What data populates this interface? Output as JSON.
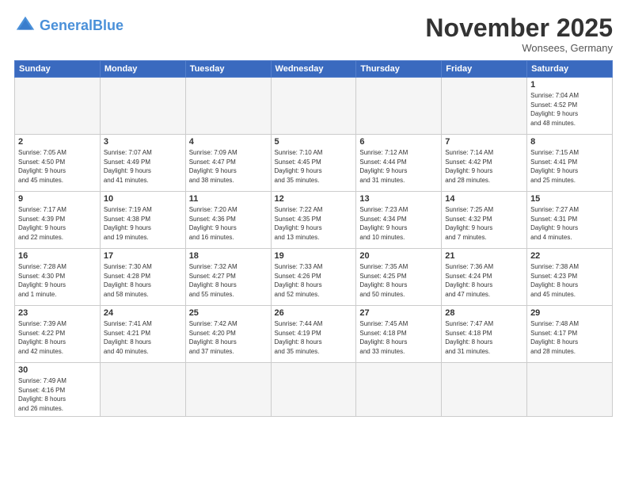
{
  "header": {
    "logo_general": "General",
    "logo_blue": "Blue",
    "month_title": "November 2025",
    "location": "Wonsees, Germany"
  },
  "weekdays": [
    "Sunday",
    "Monday",
    "Tuesday",
    "Wednesday",
    "Thursday",
    "Friday",
    "Saturday"
  ],
  "weeks": [
    [
      {
        "day": "",
        "info": ""
      },
      {
        "day": "",
        "info": ""
      },
      {
        "day": "",
        "info": ""
      },
      {
        "day": "",
        "info": ""
      },
      {
        "day": "",
        "info": ""
      },
      {
        "day": "",
        "info": ""
      },
      {
        "day": "1",
        "info": "Sunrise: 7:04 AM\nSunset: 4:52 PM\nDaylight: 9 hours\nand 48 minutes."
      }
    ],
    [
      {
        "day": "2",
        "info": "Sunrise: 7:05 AM\nSunset: 4:50 PM\nDaylight: 9 hours\nand 45 minutes."
      },
      {
        "day": "3",
        "info": "Sunrise: 7:07 AM\nSunset: 4:49 PM\nDaylight: 9 hours\nand 41 minutes."
      },
      {
        "day": "4",
        "info": "Sunrise: 7:09 AM\nSunset: 4:47 PM\nDaylight: 9 hours\nand 38 minutes."
      },
      {
        "day": "5",
        "info": "Sunrise: 7:10 AM\nSunset: 4:45 PM\nDaylight: 9 hours\nand 35 minutes."
      },
      {
        "day": "6",
        "info": "Sunrise: 7:12 AM\nSunset: 4:44 PM\nDaylight: 9 hours\nand 31 minutes."
      },
      {
        "day": "7",
        "info": "Sunrise: 7:14 AM\nSunset: 4:42 PM\nDaylight: 9 hours\nand 28 minutes."
      },
      {
        "day": "8",
        "info": "Sunrise: 7:15 AM\nSunset: 4:41 PM\nDaylight: 9 hours\nand 25 minutes."
      }
    ],
    [
      {
        "day": "9",
        "info": "Sunrise: 7:17 AM\nSunset: 4:39 PM\nDaylight: 9 hours\nand 22 minutes."
      },
      {
        "day": "10",
        "info": "Sunrise: 7:19 AM\nSunset: 4:38 PM\nDaylight: 9 hours\nand 19 minutes."
      },
      {
        "day": "11",
        "info": "Sunrise: 7:20 AM\nSunset: 4:36 PM\nDaylight: 9 hours\nand 16 minutes."
      },
      {
        "day": "12",
        "info": "Sunrise: 7:22 AM\nSunset: 4:35 PM\nDaylight: 9 hours\nand 13 minutes."
      },
      {
        "day": "13",
        "info": "Sunrise: 7:23 AM\nSunset: 4:34 PM\nDaylight: 9 hours\nand 10 minutes."
      },
      {
        "day": "14",
        "info": "Sunrise: 7:25 AM\nSunset: 4:32 PM\nDaylight: 9 hours\nand 7 minutes."
      },
      {
        "day": "15",
        "info": "Sunrise: 7:27 AM\nSunset: 4:31 PM\nDaylight: 9 hours\nand 4 minutes."
      }
    ],
    [
      {
        "day": "16",
        "info": "Sunrise: 7:28 AM\nSunset: 4:30 PM\nDaylight: 9 hours\nand 1 minute."
      },
      {
        "day": "17",
        "info": "Sunrise: 7:30 AM\nSunset: 4:28 PM\nDaylight: 8 hours\nand 58 minutes."
      },
      {
        "day": "18",
        "info": "Sunrise: 7:32 AM\nSunset: 4:27 PM\nDaylight: 8 hours\nand 55 minutes."
      },
      {
        "day": "19",
        "info": "Sunrise: 7:33 AM\nSunset: 4:26 PM\nDaylight: 8 hours\nand 52 minutes."
      },
      {
        "day": "20",
        "info": "Sunrise: 7:35 AM\nSunset: 4:25 PM\nDaylight: 8 hours\nand 50 minutes."
      },
      {
        "day": "21",
        "info": "Sunrise: 7:36 AM\nSunset: 4:24 PM\nDaylight: 8 hours\nand 47 minutes."
      },
      {
        "day": "22",
        "info": "Sunrise: 7:38 AM\nSunset: 4:23 PM\nDaylight: 8 hours\nand 45 minutes."
      }
    ],
    [
      {
        "day": "23",
        "info": "Sunrise: 7:39 AM\nSunset: 4:22 PM\nDaylight: 8 hours\nand 42 minutes."
      },
      {
        "day": "24",
        "info": "Sunrise: 7:41 AM\nSunset: 4:21 PM\nDaylight: 8 hours\nand 40 minutes."
      },
      {
        "day": "25",
        "info": "Sunrise: 7:42 AM\nSunset: 4:20 PM\nDaylight: 8 hours\nand 37 minutes."
      },
      {
        "day": "26",
        "info": "Sunrise: 7:44 AM\nSunset: 4:19 PM\nDaylight: 8 hours\nand 35 minutes."
      },
      {
        "day": "27",
        "info": "Sunrise: 7:45 AM\nSunset: 4:18 PM\nDaylight: 8 hours\nand 33 minutes."
      },
      {
        "day": "28",
        "info": "Sunrise: 7:47 AM\nSunset: 4:18 PM\nDaylight: 8 hours\nand 31 minutes."
      },
      {
        "day": "29",
        "info": "Sunrise: 7:48 AM\nSunset: 4:17 PM\nDaylight: 8 hours\nand 28 minutes."
      }
    ],
    [
      {
        "day": "30",
        "info": "Sunrise: 7:49 AM\nSunset: 4:16 PM\nDaylight: 8 hours\nand 26 minutes."
      },
      {
        "day": "",
        "info": ""
      },
      {
        "day": "",
        "info": ""
      },
      {
        "day": "",
        "info": ""
      },
      {
        "day": "",
        "info": ""
      },
      {
        "day": "",
        "info": ""
      },
      {
        "day": "",
        "info": ""
      }
    ]
  ]
}
